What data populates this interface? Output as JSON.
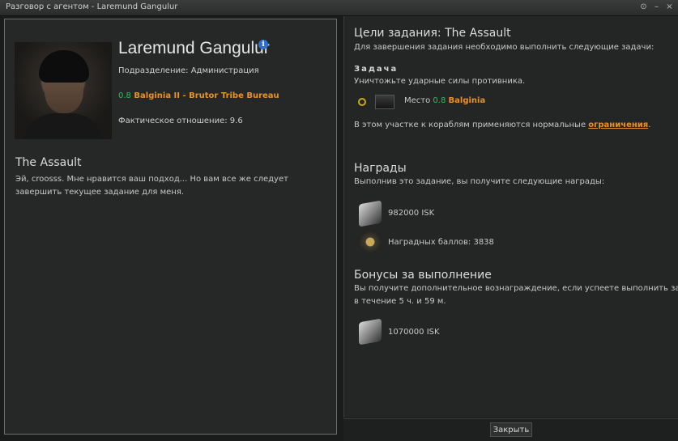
{
  "window": {
    "title": "Разговор с агентом - Laremund Gangulur",
    "btn_min_glyph": "⊙",
    "btn_collapse_glyph": "–",
    "btn_close_glyph": "×"
  },
  "agent": {
    "name": "Laremund Gangulur",
    "info_glyph": "i",
    "division": "Подразделение: Администрация",
    "security": "0.8",
    "location": "Balginia II - Brutor Tribe Bureau",
    "standing": "Фактическое отношение: 9.6"
  },
  "mission": {
    "title": "The Assault",
    "dialog": "Эй, croosss. Мне нравится ваш подход... Но вам все же следует завершить текущее задание для меня."
  },
  "objectives": {
    "heading": "Цели задания: The Assault",
    "intro": "Для завершения задания необходимо выполнить следующие задачи:",
    "task_label": "Задача",
    "task_text": "Уничтожьте ударные силы противника.",
    "place_label": "Место",
    "place_security": "0.8",
    "place_name": "Balginia",
    "restriction_prefix": "В этом участке к кораблям применяются нормальные ",
    "restriction_link": "ограничения",
    "restriction_suffix": "."
  },
  "rewards": {
    "heading": "Награды",
    "intro": "Выполнив это задание, вы получите следующие награды:",
    "isk": "982000 ISK",
    "lp": "Наградных баллов: 3838"
  },
  "bonus": {
    "heading": "Бонусы за выполнение",
    "intro_line1": "Вы получите дополнительное вознаграждение, если успеете выполнить задание",
    "intro_line2": "в течение 5 ч. и 59 м.",
    "isk": "1070000 ISK"
  },
  "footer": {
    "close_label": "Закрыть"
  },
  "colors": {
    "accent_orange": "#e8912a",
    "security_green": "#2ac05b",
    "info_blue": "#2f6fd1"
  },
  "icons": [
    "minimize-icon",
    "collapse-icon",
    "close-icon",
    "info-icon",
    "objective-marker-icon",
    "location-thumbnail-icon",
    "isk-icon",
    "loyalty-points-icon"
  ]
}
